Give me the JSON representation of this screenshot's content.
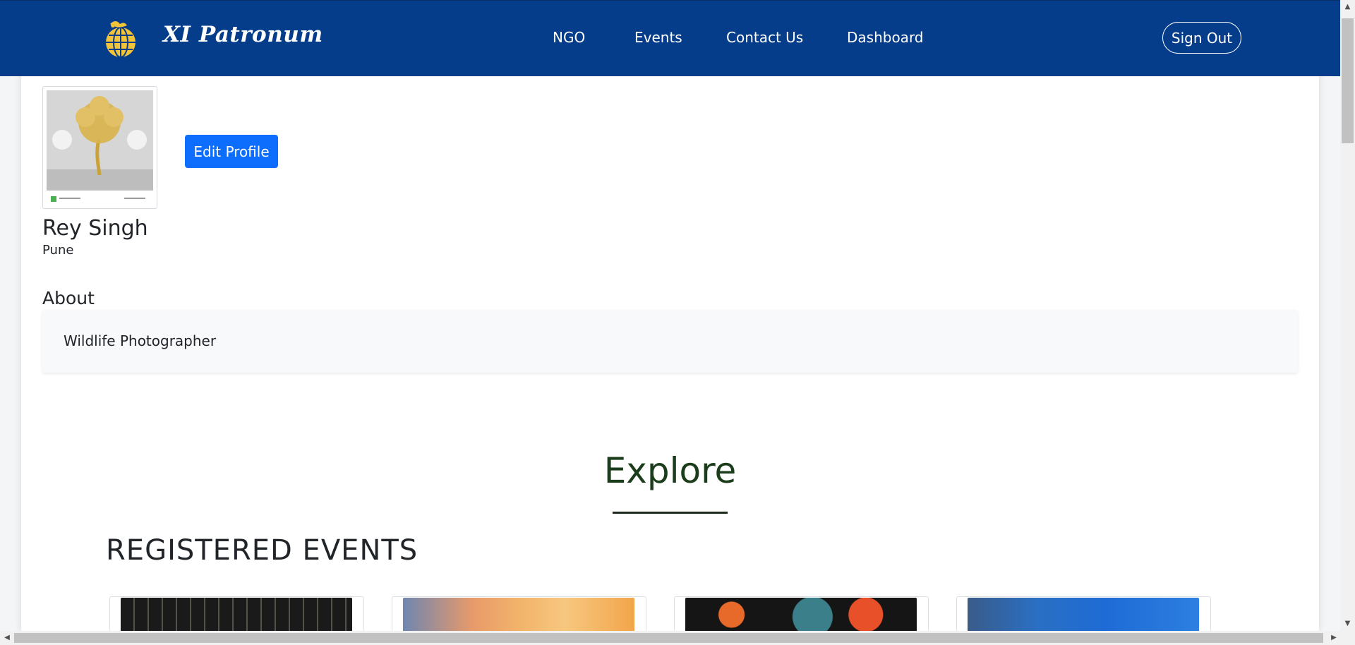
{
  "navbar": {
    "brand": "XI Patronum",
    "links": [
      "NGO",
      "Events",
      "Contact Us",
      "Dashboard"
    ],
    "sign_out": "Sign Out"
  },
  "profile": {
    "name": "Rey Singh",
    "city": "Pune",
    "edit_button": "Edit Profile"
  },
  "about": {
    "heading": "About",
    "text": "Wildlife Photographer"
  },
  "explore": {
    "title": "Explore",
    "section_heading": "REGISTERED EVENTS"
  },
  "colors": {
    "navbar": "#063d8a",
    "primary_button": "#0d6efd",
    "explore_title": "#1b3d1b"
  }
}
